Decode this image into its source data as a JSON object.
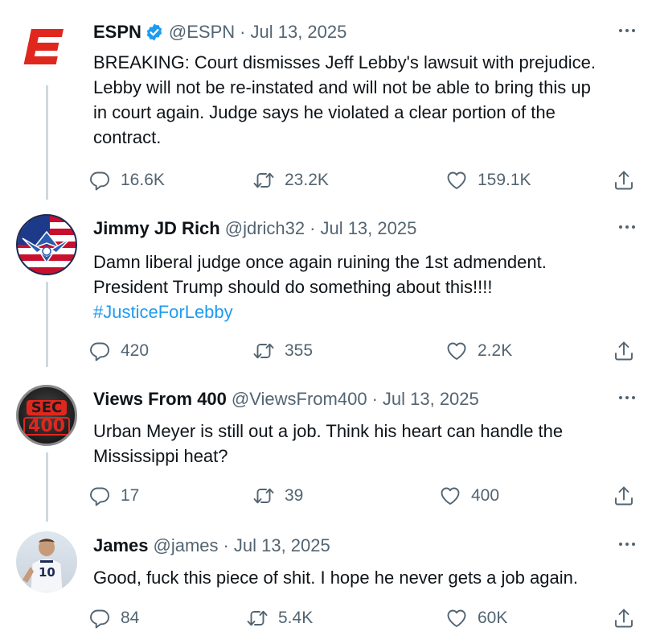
{
  "tweets": [
    {
      "name": "ESPN",
      "verified": true,
      "handle": "@ESPN",
      "separator": "·",
      "date": "Jul 13, 2025",
      "lines": [
        "BREAKING: Court dismisses Jeff Lebby's lawsuit with prejudice.",
        "Lebby will not be re-instated and will not be able to bring this up",
        "in court again. Judge says he violated a clear portion of the",
        "contract."
      ],
      "replies": "16.6K",
      "retweets": "23.2K",
      "likes": "159.1K"
    },
    {
      "name": "Jimmy JD Rich",
      "verified": false,
      "handle": "@jdrich32",
      "separator": "·",
      "date": "Jul 13, 2025",
      "lines": [
        "Damn liberal judge once again ruining the 1st admendent.",
        "President Trump should do something about this!!!!"
      ],
      "hashtag": "#JusticeForLebby",
      "replies": "420",
      "retweets": "355",
      "likes": "2.2K"
    },
    {
      "name": "Views From 400",
      "verified": false,
      "handle": "@ViewsFrom400",
      "separator": "·",
      "date": "Jul 13, 2025",
      "lines": [
        "Urban Meyer is still out a job. Think his heart can handle the",
        "Mississippi heat?"
      ],
      "avatar_text_top": "SEC",
      "avatar_text_bottom": "400",
      "replies": "17",
      "retweets": "39",
      "likes": "400"
    },
    {
      "name": "James",
      "verified": false,
      "handle": "@james",
      "separator": "·",
      "date": "Jul 13, 2025",
      "lines": [
        "Good, fuck this piece of shit. I hope he never gets a job again."
      ],
      "jersey_number": "10",
      "replies": "84",
      "retweets": "5.4K",
      "likes": "60K"
    }
  ],
  "colors": {
    "text": "#0f1419",
    "secondary": "#536471",
    "link": "#1d9bf0",
    "verified": "#1d9bf0",
    "thread_line": "#cfd9de",
    "espn_red": "#e0271e"
  },
  "icons": {
    "reply": "reply-icon",
    "retweet": "retweet-icon",
    "like": "like-icon",
    "share": "share-icon",
    "more": "more-icon",
    "verified": "verified-badge-icon"
  }
}
